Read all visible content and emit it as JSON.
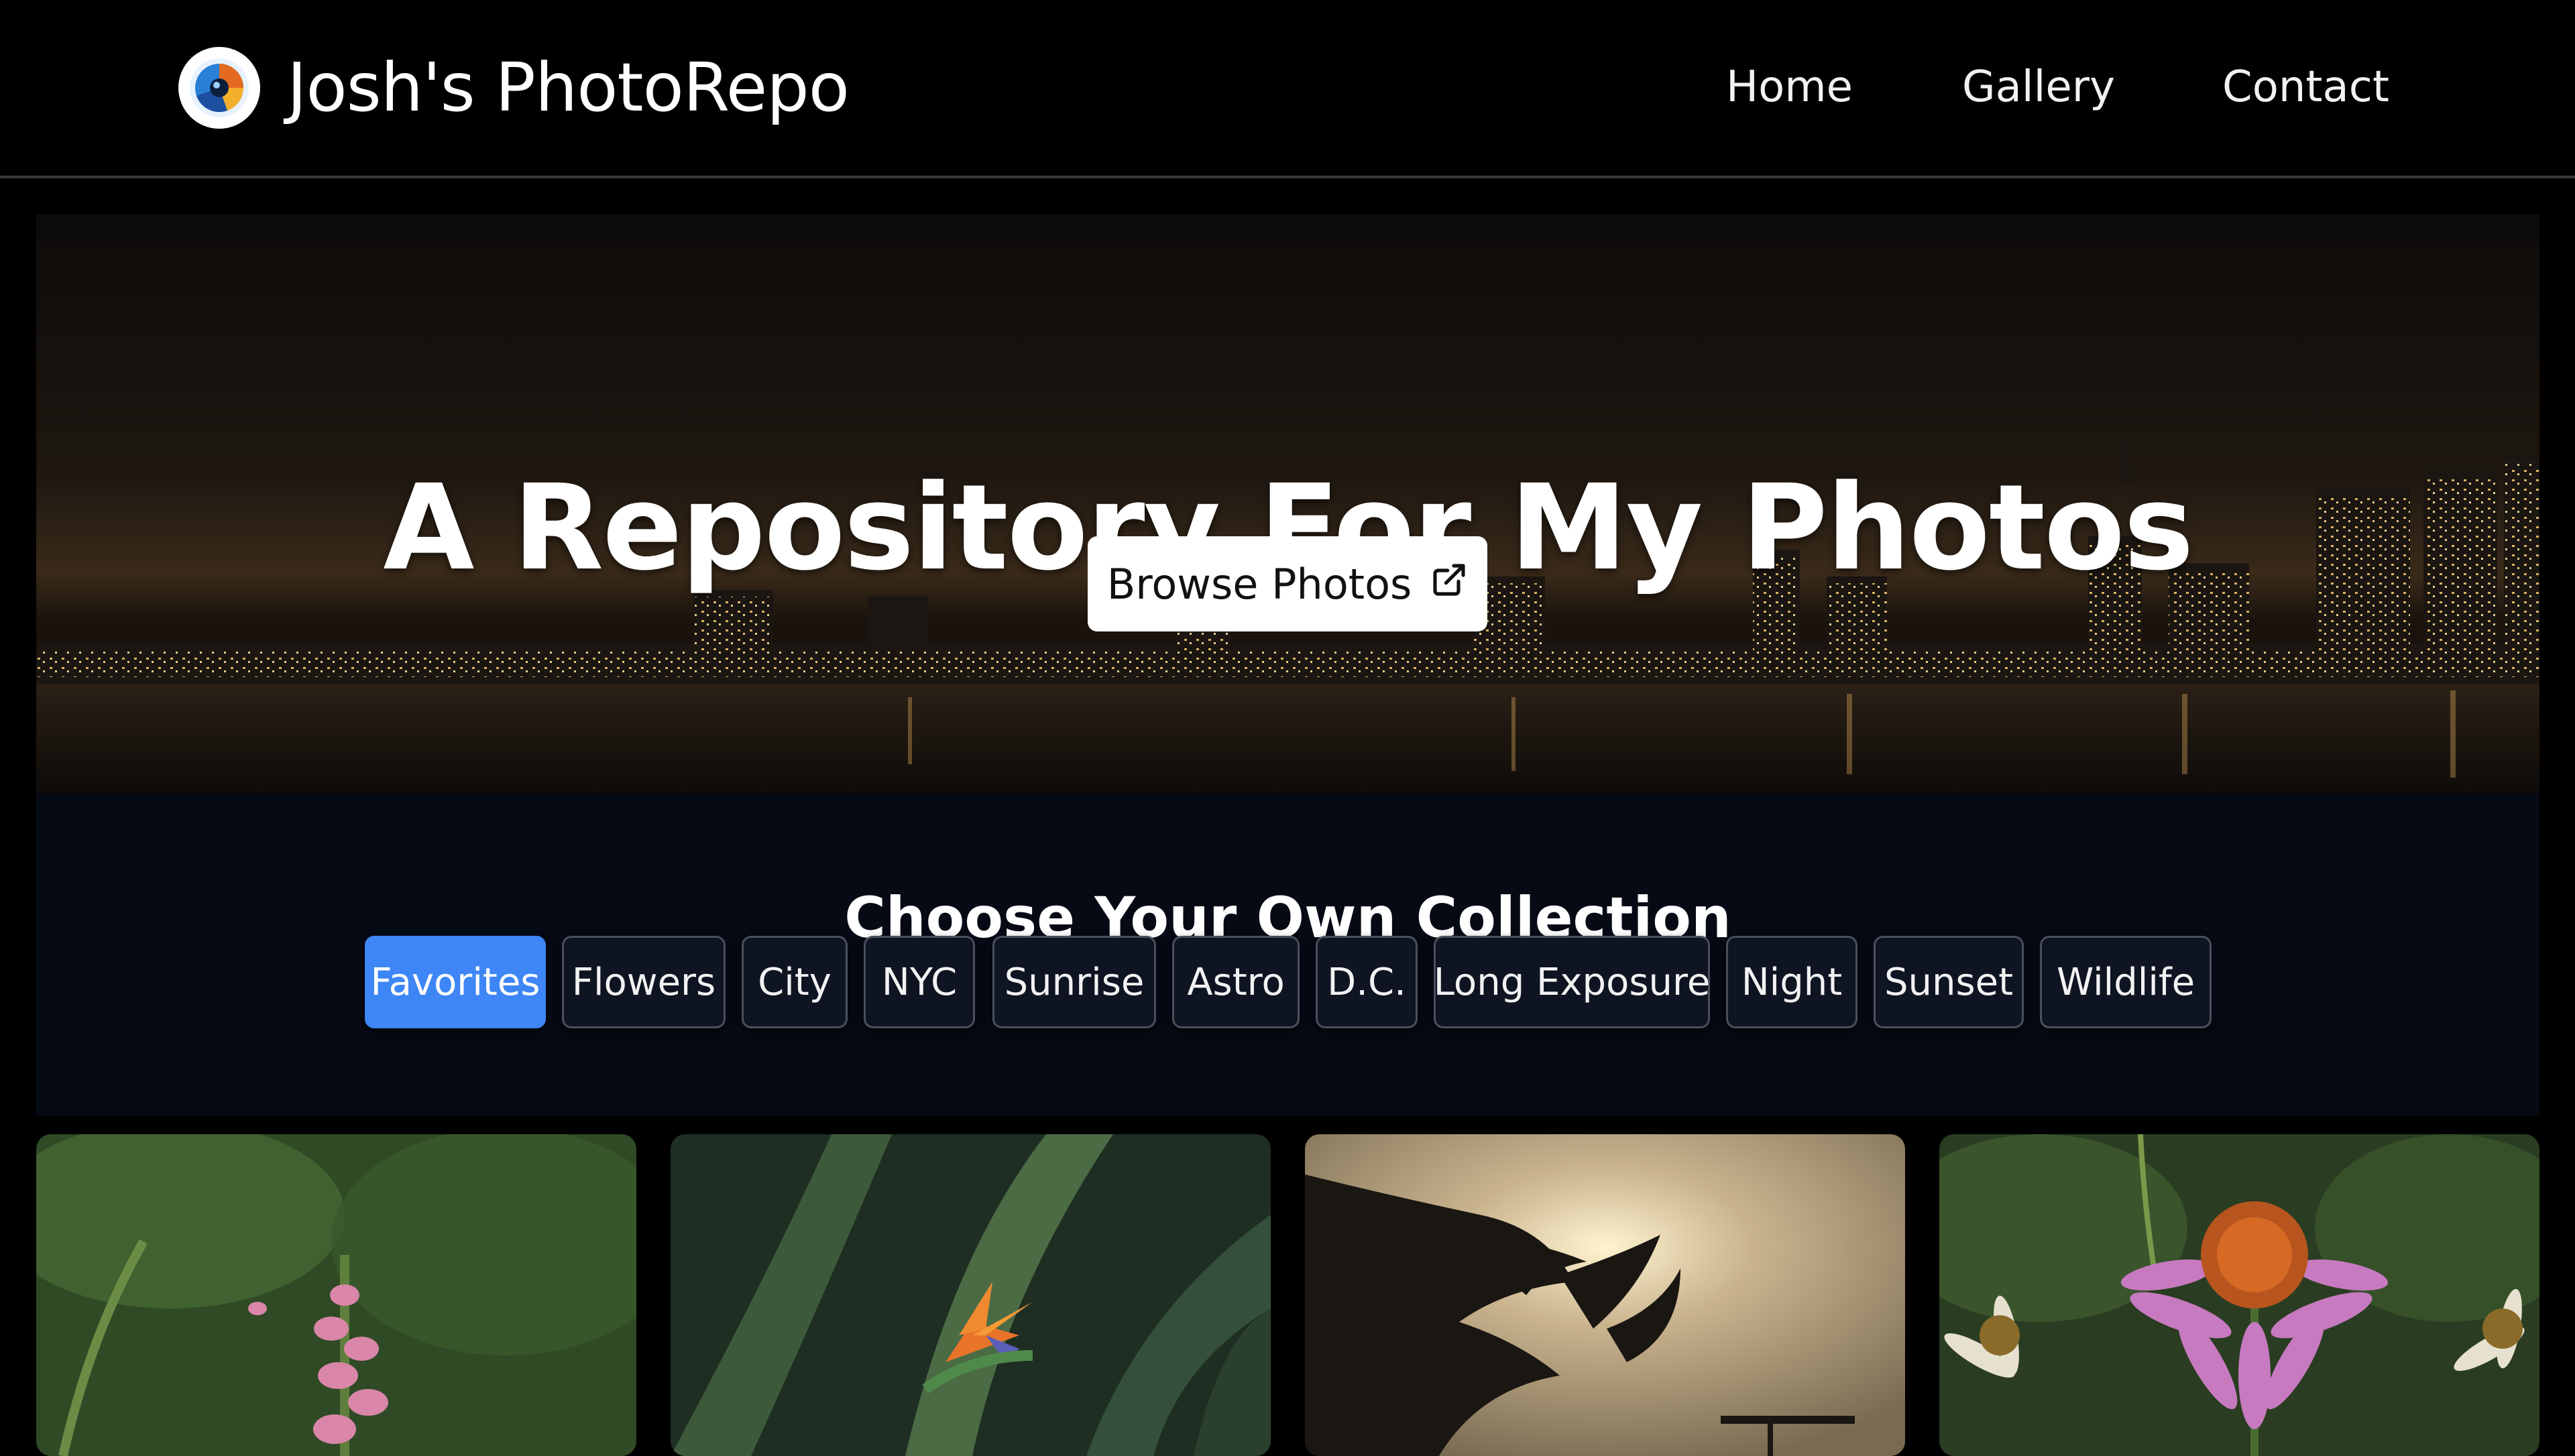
{
  "navbar": {
    "brand_title": "Josh's PhotoRepo",
    "logo_icon": "camera-aperture-logo",
    "links": [
      {
        "label": "Home"
      },
      {
        "label": "Gallery"
      },
      {
        "label": "Contact"
      }
    ]
  },
  "hero": {
    "title": "A Repository For My Photos",
    "browse_button": "Browse Photos",
    "browse_icon": "external-link-icon"
  },
  "collection": {
    "title": "Choose Your Own Collection",
    "active": "Favorites",
    "chips": [
      {
        "label": "Favorites"
      },
      {
        "label": "Flowers"
      },
      {
        "label": "City"
      },
      {
        "label": "NYC"
      },
      {
        "label": "Sunrise"
      },
      {
        "label": "Astro"
      },
      {
        "label": "D.C."
      },
      {
        "label": "Long Exposure"
      },
      {
        "label": "Night"
      },
      {
        "label": "Sunset"
      },
      {
        "label": "Wildlife"
      }
    ]
  },
  "gallery": {
    "photos": [
      {
        "subject": "pink snapdragon flowers in green foliage"
      },
      {
        "subject": "bird of paradise flower among large leaves"
      },
      {
        "subject": "pine tree silhouette at sunset"
      },
      {
        "subject": "pink coneflower with orange center"
      }
    ]
  },
  "colors": {
    "background": "#000000",
    "accent": "#3e86f5",
    "collection_bg": "#060a15",
    "chip_bg": "#0f1422"
  }
}
